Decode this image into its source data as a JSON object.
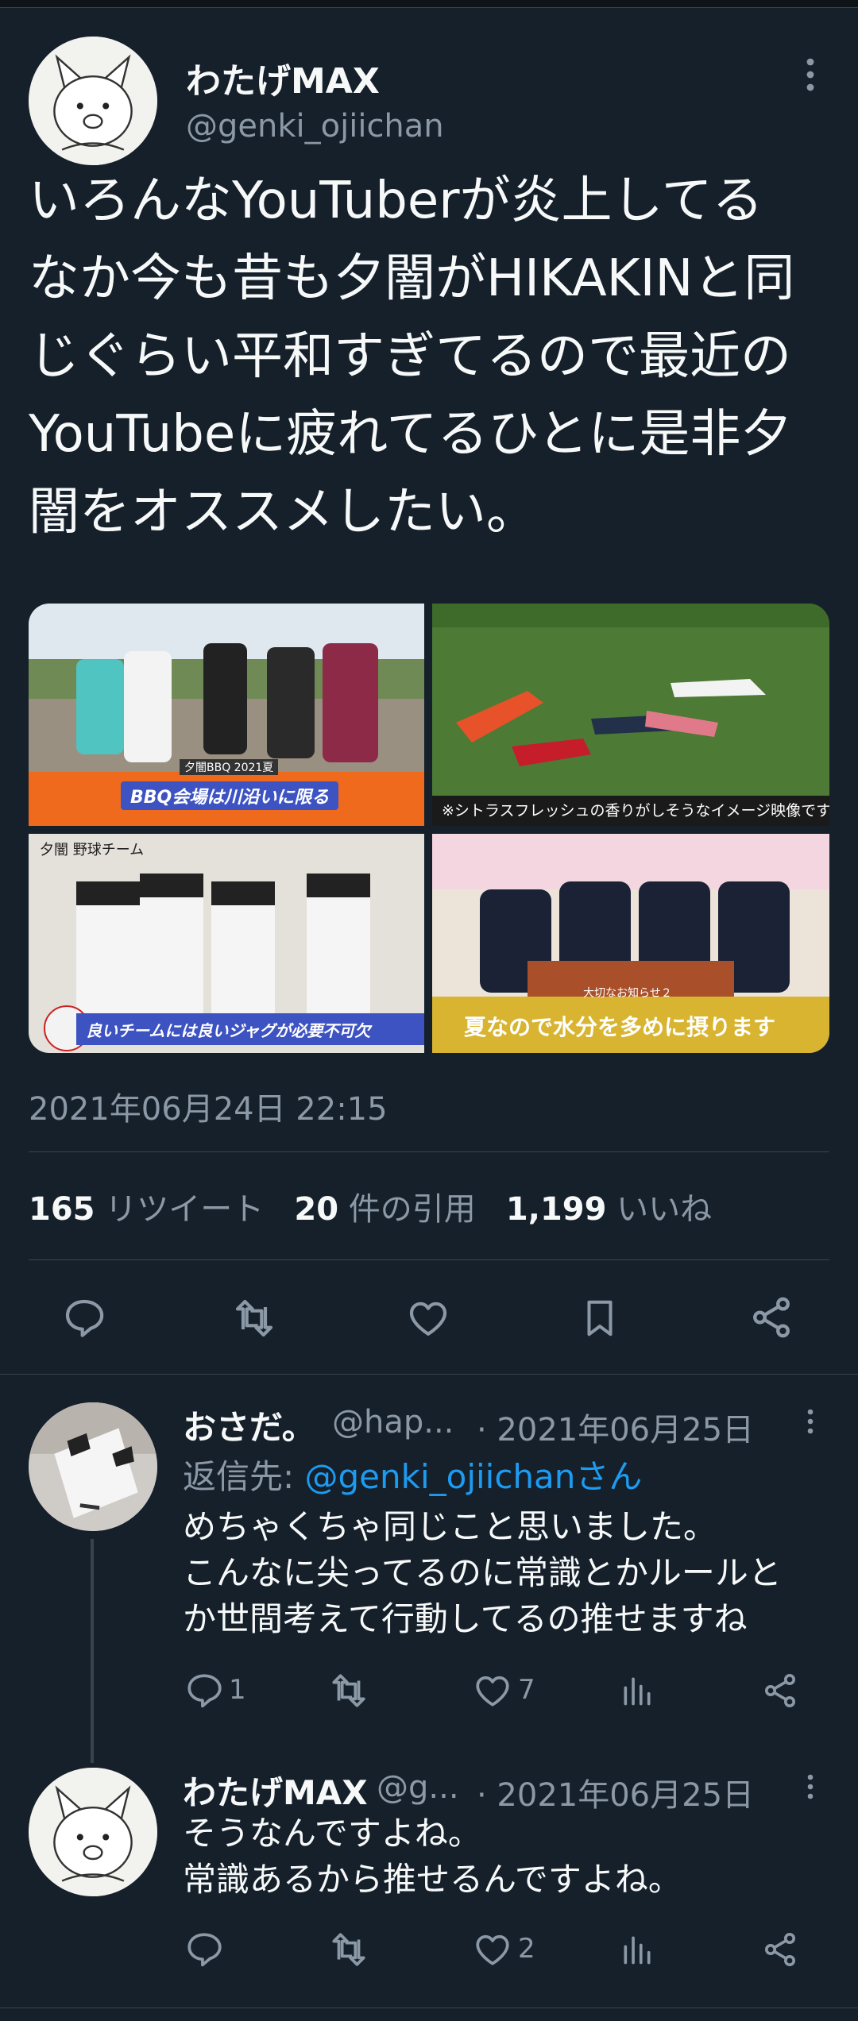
{
  "tweet": {
    "author_name": "わたげMAX",
    "author_handle": "@genki_ojiichan",
    "text": "いろんなYouTuberが炎上してる\nなか今も昔も夕闇がHIKAKINと同\nじぐらい平和すぎてるので最近の\nYouTubeに疲れてるひとに是非夕\n闇をオススメしたい。",
    "images": [
      {
        "caption": "BBQ会場は川沿いに限る",
        "badge": "夕闇BBQ 2021夏"
      },
      {
        "caption": "※シトラスフレッシュの香りがしそうなイメージ映像です"
      },
      {
        "caption": "良いチームには良いジャグが必要不可欠",
        "badge": "夕闇 野球チーム"
      },
      {
        "caption": "夏なので水分を多めに摂ります",
        "badge": "大切なお知らせ２"
      }
    ],
    "timestamp": "2021年06月24日 22:15",
    "stats": {
      "retweets": "165",
      "retweets_label": "リツイート",
      "quotes": "20",
      "quotes_label": "件の引用",
      "likes": "1,199",
      "likes_label": "いいね"
    }
  },
  "replies": [
    {
      "name": "おさだ。",
      "handle": "@hap...",
      "date": "· 2021年06月25日",
      "reply_to_prefix": "返信先: ",
      "reply_to_handle": "@genki_ojiichanさん",
      "text": "めちゃくちゃ同じこと思いました。\nこんなに尖ってるのに常識とかルールと\nか世間考えて行動してるの推せますね",
      "reply_count": "1",
      "retweet_count": "",
      "like_count": "7"
    },
    {
      "name": "わたげMAX",
      "handle": "@g...",
      "date": "· 2021年06月25日",
      "text": "そうなんですよね。\n常識あるから推せるんですよね。",
      "reply_count": "",
      "retweet_count": "",
      "like_count": "2"
    }
  ],
  "colors": {
    "background": "#15202b",
    "accent": "#1d9bf0",
    "muted": "#8b98a5"
  }
}
